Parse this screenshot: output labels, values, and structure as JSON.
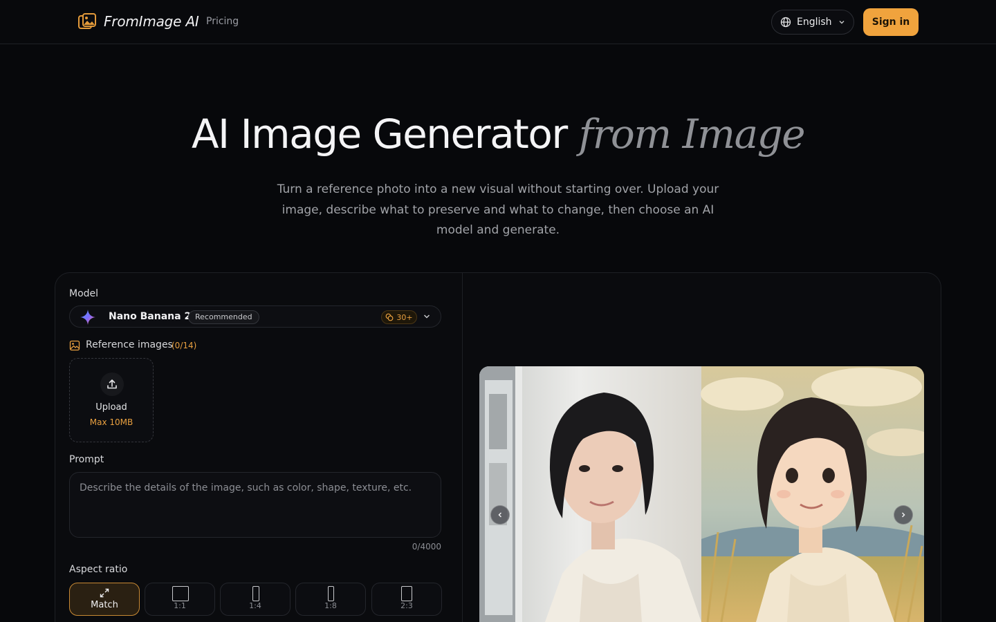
{
  "header": {
    "brand": "FromImage AI",
    "nav_pricing": "Pricing",
    "language": "English",
    "signin": "Sign in"
  },
  "hero": {
    "title_main": "AI Image Generator",
    "title_accent": "from Image",
    "subtitle": "Turn a reference photo into a new visual without starting over. Upload your image, describe what to preserve and what to change, then choose an AI model and generate."
  },
  "form": {
    "model_label": "Model",
    "model_name": "Nano Banana 2",
    "model_badge": "Recommended",
    "model_credits": "30+",
    "ref_label": "Reference images",
    "ref_count": "(0/14)",
    "upload_label": "Upload",
    "upload_max": "Max 10MB",
    "prompt_label": "Prompt",
    "prompt_placeholder": "Describe the details of the image, such as color, shape, texture, etc.",
    "prompt_value": "",
    "prompt_counter": "0/4000",
    "aspect_label": "Aspect ratio",
    "ratios": [
      "Match",
      "1:1",
      "1:4",
      "1:8",
      "2:3"
    ],
    "selected_ratio": "Match"
  },
  "colors": {
    "accent": "#f0a33d",
    "background": "#07080b"
  }
}
